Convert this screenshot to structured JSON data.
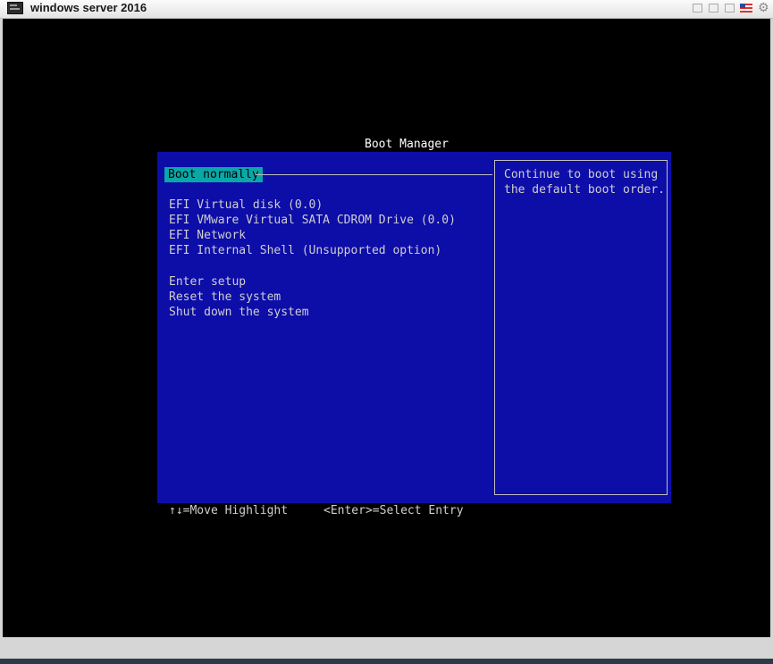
{
  "window": {
    "title": "windows server 2016",
    "controls": [
      "restore-icon",
      "minimize-icon",
      "maximize-icon",
      "flag-icon",
      "gear-icon"
    ]
  },
  "boot": {
    "heading": "Boot Manager",
    "selected": "Boot normally",
    "devices": [
      "EFI Virtual disk (0.0)",
      "EFI VMware Virtual SATA CDROM Drive (0.0)",
      "EFI Network",
      "EFI Internal Shell (Unsupported option)"
    ],
    "actions": [
      "Enter setup",
      "Reset the system",
      "Shut down the system"
    ],
    "help": [
      "Continue to boot using",
      "the default boot order."
    ],
    "footer": {
      "move": "↑↓=Move Highlight",
      "select": "<Enter>=Select Entry"
    }
  },
  "colors": {
    "panel": "#0d0da8",
    "highlight": "#0aa7a7",
    "text": "#cfcfcf"
  }
}
